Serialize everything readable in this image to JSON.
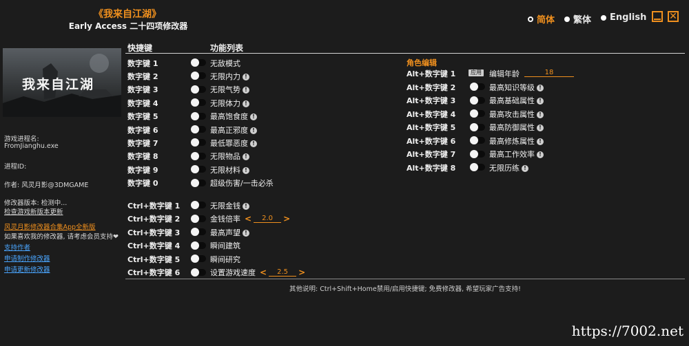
{
  "header": {
    "title": "《我来自江湖》",
    "subtitle": "Early Access 二十四项修改器"
  },
  "languages": [
    {
      "label": "简体",
      "active": true
    },
    {
      "label": "繁体",
      "active": false
    },
    {
      "label": "English",
      "active": false
    }
  ],
  "banner": {
    "text": "我来自江湖"
  },
  "left": {
    "process_label": "游戏进程名:",
    "process_value": "FromJianghu.exe",
    "pid_label": "进程ID:",
    "author": "作者: 风灵月影@3DMGAME",
    "version_label": "修改器版本: 检测中...",
    "check_update": "检查游戏新版本更新",
    "app_link": "风灵月影修改器合集App全新版",
    "support_text": "如果喜欢我的修改器, 请考虑会员支持❤",
    "links": [
      "支持作者",
      "申请制作修改器",
      "申请更新修改器"
    ]
  },
  "columns": {
    "hotkey": "快捷键",
    "features": "功能列表"
  },
  "left_features": [
    {
      "key": "数字键 1",
      "label": "无敌模式",
      "info": false
    },
    {
      "key": "数字键 2",
      "label": "无限内力",
      "info": true
    },
    {
      "key": "数字键 3",
      "label": "无限气势",
      "info": true
    },
    {
      "key": "数字键 4",
      "label": "无限体力",
      "info": true
    },
    {
      "key": "数字键 5",
      "label": "最高饱食度",
      "info": true
    },
    {
      "key": "数字键 6",
      "label": "最高正邪度",
      "info": true
    },
    {
      "key": "数字键 7",
      "label": "最低罪恶度",
      "info": true
    },
    {
      "key": "数字键 8",
      "label": "无限物品",
      "info": true
    },
    {
      "key": "数字键 9",
      "label": "无限材料",
      "info": true
    },
    {
      "key": "数字键 0",
      "label": "超级伤害/一击必杀",
      "info": false
    }
  ],
  "ctrl_features": [
    {
      "key": "Ctrl+数字键 1",
      "label": "无限金钱",
      "info": true
    },
    {
      "key": "Ctrl+数字键 2",
      "label": "金钱倍率",
      "info": false,
      "value": "2.0"
    },
    {
      "key": "Ctrl+数字键 3",
      "label": "最高声望",
      "info": true
    },
    {
      "key": "Ctrl+数字键 4",
      "label": "瞬间建筑",
      "info": false
    },
    {
      "key": "Ctrl+数字键 5",
      "label": "瞬间研究",
      "info": false
    },
    {
      "key": "Ctrl+数字键 6",
      "label": "设置游戏速度",
      "info": false,
      "value": "2.5"
    }
  ],
  "role_edit": {
    "title": "角色编辑",
    "age": {
      "key": "Alt+数字键 1",
      "apply": "应用",
      "label": "编辑年龄",
      "value": "18"
    },
    "features": [
      {
        "key": "Alt+数字键 2",
        "label": "最高知识等级",
        "info": true
      },
      {
        "key": "Alt+数字键 3",
        "label": "最高基础属性",
        "info": true
      },
      {
        "key": "Alt+数字键 4",
        "label": "最高攻击属性",
        "info": true
      },
      {
        "key": "Alt+数字键 5",
        "label": "最高防御属性",
        "info": true
      },
      {
        "key": "Alt+数字键 6",
        "label": "最高修炼属性",
        "info": true
      },
      {
        "key": "Alt+数字键 7",
        "label": "最高工作效率",
        "info": true
      },
      {
        "key": "Alt+数字键 8",
        "label": "无限历练",
        "info": true
      }
    ]
  },
  "footer": "其他说明: Ctrl+Shift+Home禁用/启用快捷键; 免费修改器, 希望玩家广告支持!",
  "watermark": "https://7002.net"
}
